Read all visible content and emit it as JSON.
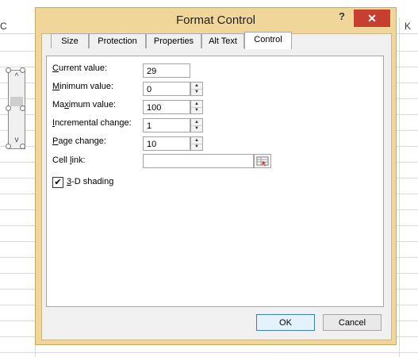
{
  "sheet": {
    "col_left": "C",
    "col_right": "K"
  },
  "dialog": {
    "title": "Format Control",
    "help": "?",
    "close": "✕",
    "tabs": [
      {
        "label": "Size"
      },
      {
        "label": "Protection"
      },
      {
        "label": "Properties"
      },
      {
        "label": "Alt Text"
      },
      {
        "label": "Control"
      }
    ],
    "active_tab": "Control",
    "fields": {
      "current_value": {
        "label_u": "C",
        "label_rest": "urrent value:",
        "value": "29"
      },
      "minimum_value": {
        "label_u": "M",
        "label_rest": "inimum value:",
        "value": "0"
      },
      "maximum_value": {
        "label_pre": "Ma",
        "label_u": "x",
        "label_rest": "imum value:",
        "value": "100"
      },
      "incremental_change": {
        "label_u": "I",
        "label_rest": "ncremental change:",
        "value": "1"
      },
      "page_change": {
        "label_u": "P",
        "label_rest": "age change:",
        "value": "10"
      },
      "cell_link": {
        "label_pre": "Cell ",
        "label_u": "l",
        "label_rest": "ink:",
        "value": ""
      }
    },
    "shading": {
      "checked": true,
      "label_u": "3",
      "label_rest": "-D shading",
      "mark": "✔"
    },
    "buttons": {
      "ok": "OK",
      "cancel": "Cancel"
    }
  },
  "colors": {
    "dialog_frame": "#f1d69a",
    "close_button": "#c7402f"
  }
}
